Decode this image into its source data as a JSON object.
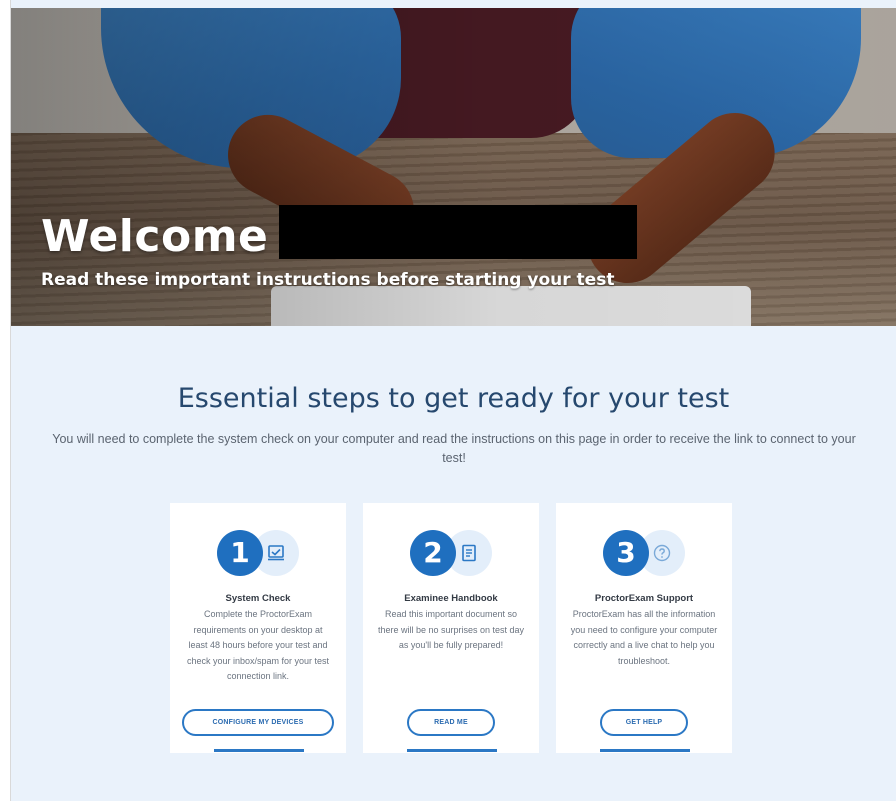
{
  "hero": {
    "welcome": "Welcome",
    "subtitle": "Read these important instructions before starting your test"
  },
  "main": {
    "title": "Essential steps to get ready for your test",
    "description": "You will need to complete the system check on your computer and read the instructions on this page in order to receive the link to connect to your test!"
  },
  "steps": [
    {
      "number": "1",
      "icon": "laptop-check-icon",
      "title": "System Check",
      "text": "Complete the ProctorExam requirements on your desktop at least 48 hours before your test and check your inbox/spam for your test connection link.",
      "button": "CONFIGURE MY DEVICES"
    },
    {
      "number": "2",
      "icon": "document-icon",
      "title": "Examinee Handbook",
      "text": "Read this important document so there will be no surprises on test day as you'll be fully prepared!",
      "button": "READ ME"
    },
    {
      "number": "3",
      "icon": "help-circle-icon",
      "title": "ProctorExam Support",
      "text": "ProctorExam has all the information you need to configure your computer correctly and a live chat to help you troubleshoot.",
      "button": "GET HELP"
    }
  ],
  "colors": {
    "accent": "#1f6fbf",
    "title": "#26486e",
    "background": "#eaf2fb"
  }
}
